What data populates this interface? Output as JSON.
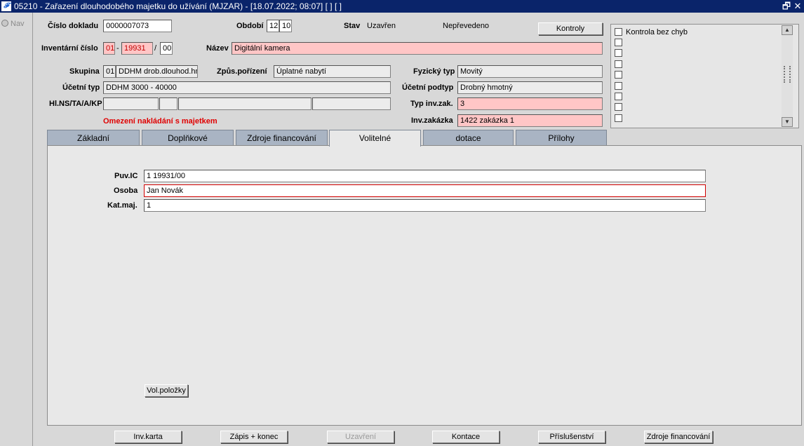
{
  "window": {
    "title": "05210 - Zařazení dlouhodobého majetku do užívání (MJZAR) - [18.07.2022; 08:07]  [ ]  [ ]",
    "app_icon": "𝓕",
    "restore_glyph": "🗗",
    "close_glyph": "✕"
  },
  "nav": {
    "label": "Nav"
  },
  "header": {
    "cislo_dokladu_label": "Číslo dokladu",
    "cislo_dokladu_value": "0000007073",
    "obdobi_label": "Období",
    "obdobi_value1": "12",
    "obdobi_value2": "10",
    "stav_label": "Stav",
    "stav_value": "Uzavřen",
    "neprevedeno": "Nepřevedeno",
    "kontroly_button": "Kontroly",
    "inventarni_cislo_label": "Inventární číslo",
    "inv_part1": "01",
    "inv_sep1": "-",
    "inv_part2": "19931",
    "inv_sep2": "/",
    "inv_part3": "00",
    "nazev_label": "Název",
    "nazev_value": "Digitální kamera",
    "skupina_label": "Skupina",
    "skupina_code": "01",
    "skupina_value": "DDHM drob.dlouhod.hm",
    "zpusob_label": "Způs.pořízení",
    "zpusob_value": "Úplatné nabytí",
    "fyzicky_typ_label": "Fyzický typ",
    "fyzicky_typ_value": "Movitý",
    "ucetni_typ_label": "Účetní typ",
    "ucetni_typ_value": "DDHM 3000 - 40000",
    "ucetni_podtyp_label": "Účetní podtyp",
    "ucetni_podtyp_value": "Drobný hmotný",
    "hlns_label": "Hl.NS/TA/A/KP",
    "hlns_values": [
      "",
      "",
      "",
      ""
    ],
    "typ_inv_zak_label": "Typ inv.zak.",
    "typ_inv_zak_value": "3",
    "omezeni_text": "Omezení nakládání s majetkem",
    "inv_zakazka_label": "Inv.zakázka",
    "inv_zakazka_value": "1422 zakázka 1"
  },
  "checks": {
    "items": [
      {
        "label": "Kontrola bez chyb",
        "checked": false
      },
      {
        "label": "",
        "checked": false
      },
      {
        "label": "",
        "checked": false
      },
      {
        "label": "",
        "checked": false
      },
      {
        "label": "",
        "checked": false
      },
      {
        "label": "",
        "checked": false
      },
      {
        "label": "",
        "checked": false
      },
      {
        "label": "",
        "checked": false
      },
      {
        "label": "",
        "checked": false
      }
    ],
    "scroll_up": "▲",
    "scroll_down": "▼"
  },
  "tabs": [
    {
      "label": "Základní",
      "active": false
    },
    {
      "label": "Doplňkové",
      "active": false
    },
    {
      "label": "Zdroje financování",
      "active": false
    },
    {
      "label": "Volitelné",
      "active": true
    },
    {
      "label": "dotace",
      "active": false
    },
    {
      "label": "Přílohy",
      "active": false
    }
  ],
  "volitelne": {
    "puv_ic_label": "Puv.IC",
    "puv_ic_value": "1 19931/00",
    "osoba_label": "Osoba",
    "osoba_value": "Jan Novák",
    "kat_maj_label": "Kat.maj.",
    "kat_maj_value": "1",
    "vol_polozky_button": "Vol.položky"
  },
  "footer": {
    "buttons": [
      {
        "label": "Inv.karta",
        "enabled": true
      },
      {
        "label": "Zápis + konec",
        "enabled": true
      },
      {
        "label": "Uzavření",
        "enabled": false
      },
      {
        "label": "Kontace",
        "enabled": true
      },
      {
        "label": "Příslušenství",
        "enabled": true
      },
      {
        "label": "Zdroje financování",
        "enabled": true
      }
    ]
  },
  "colors": {
    "title_bar": "#0a246a",
    "required_field": "#ffc6c6",
    "error_text": "#e00000",
    "tab_inactive": "#a9b4c3"
  }
}
